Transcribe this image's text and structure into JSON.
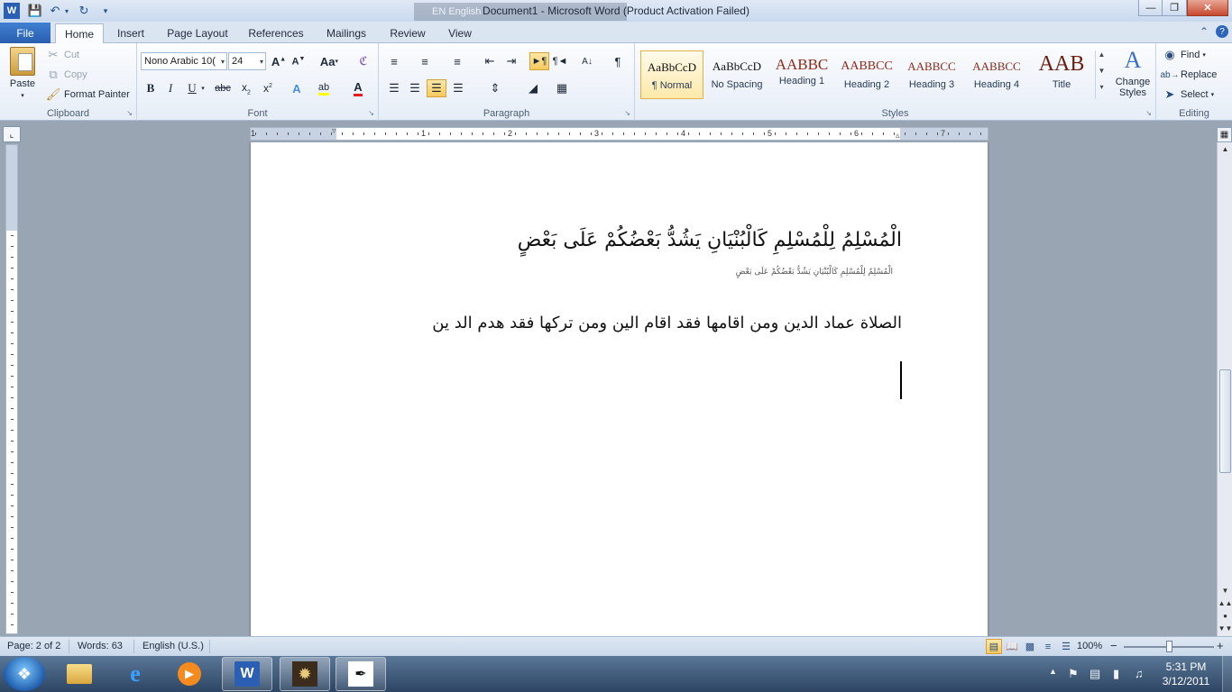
{
  "window": {
    "title": "Document1  -  Microsoft Word (Product Activation Failed)",
    "language_bar": "EN English"
  },
  "tabs": {
    "file": "File",
    "items": [
      "Home",
      "Insert",
      "Page Layout",
      "References",
      "Mailings",
      "Review",
      "View"
    ],
    "active": "Home"
  },
  "ribbon": {
    "clipboard": {
      "label": "Clipboard",
      "paste": "Paste",
      "cut": "Cut",
      "copy": "Copy",
      "format_painter": "Format Painter"
    },
    "font": {
      "label": "Font",
      "font_name": "Nono Arabic 10(",
      "font_size": "24",
      "case_label": "Aa"
    },
    "paragraph": {
      "label": "Paragraph"
    },
    "styles": {
      "label": "Styles",
      "items": [
        {
          "sample": "AaBbCcD",
          "name": "¶ Normal"
        },
        {
          "sample": "AaBbCcD",
          "name": "No Spacing"
        },
        {
          "sample": "AABBC",
          "name": "Heading 1"
        },
        {
          "sample": "AABBCC",
          "name": "Heading 2"
        },
        {
          "sample": "AABBCC",
          "name": "Heading 3"
        },
        {
          "sample": "AABBCC",
          "name": "Heading 4"
        },
        {
          "sample": "AAB",
          "name": "Title"
        }
      ],
      "change_styles": "Change Styles"
    },
    "editing": {
      "label": "Editing",
      "find": "Find",
      "replace": "Replace",
      "select": "Select"
    }
  },
  "ruler": {
    "numbers": [
      "1",
      "1",
      "2",
      "3",
      "4",
      "5",
      "6",
      "7"
    ]
  },
  "document": {
    "line1": "الْمُسْلِمُ لِلْمُسْلِمِ كَالْبُنْيَانِ يَشُدُّ بَعْضُكُمْ عَلَى بَعْضٍ",
    "line2": "الْمُسْلِمُ لِلْمُسْلِمِ كَالْبُنْيَانِ يَشُدُّ بَعْضُكُمْ عَلَى بَعْضٍ",
    "line3": "الصلاة عماد الدين ومن اقامها فقد اقام الين ومن تركها فقد هدم الد ين"
  },
  "status": {
    "page": "Page: 2 of 2",
    "words": "Words: 63",
    "language": "English (U.S.)",
    "zoom": "100%",
    "zoom_minus": "−",
    "zoom_plus": "+"
  },
  "taskbar": {
    "time": "5:31 PM",
    "date": "3/12/2011"
  }
}
